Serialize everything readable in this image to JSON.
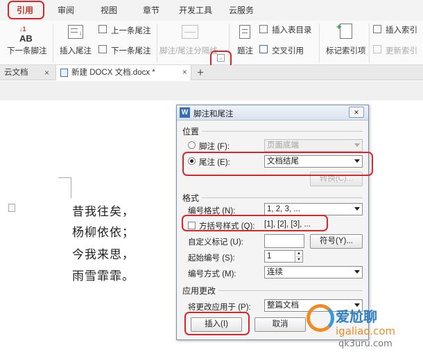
{
  "ribbon": {
    "tabs": [
      "引用",
      "审阅",
      "视图",
      "章节",
      "开发工具",
      "云服务"
    ],
    "active_tab": "引用",
    "items": {
      "next_footnote": "下一条脚注",
      "insert_endnote": "插入尾注",
      "prev_endnote": "上一条尾注",
      "next_endnote": "下一条尾注",
      "separator": "脚注/尾注分隔线",
      "caption": "题注",
      "insert_table_toc": "插入表目录",
      "cross_ref": "交叉引用",
      "mark_index": "标记索引项",
      "insert_index": "插入索引",
      "update_index": "更新索引"
    }
  },
  "doc_tabs": {
    "cloud": "云文档",
    "doc": "新建 DOCX 文档.docx *"
  },
  "document": {
    "lines": [
      "昔我往矣，",
      "杨柳依依；",
      "今我来思，",
      "雨雪霏霏。"
    ]
  },
  "dialog": {
    "title": "脚注和尾注",
    "position_label": "位置",
    "footnote_label": "脚注 (F):",
    "footnote_value": "页面底端",
    "endnote_label": "尾注 (E):",
    "endnote_value": "文档结尾",
    "convert_btn": "转换(C)...",
    "format_label": "格式",
    "number_format_label": "编号格式 (N):",
    "number_format_value": "1, 2, 3, ...",
    "bracket_label": "方括号样式 (Q):",
    "bracket_value": "[1], [2], [3], ...",
    "custom_mark_label": "自定义标记 (U):",
    "custom_mark_value": "",
    "symbol_btn": "符号(Y)...",
    "start_at_label": "起始编号 (S):",
    "start_at_value": "1",
    "numbering_label": "编号方式 (M):",
    "numbering_value": "连续",
    "apply_label": "应用更改",
    "apply_to_label": "将更改应用于 (P):",
    "apply_to_value": "整篇文档",
    "insert_btn": "插入(I)",
    "cancel_btn": "取消"
  },
  "watermark": {
    "line1": "爱尬聊",
    "line2": "igaliao.com",
    "line3": "qk3uru.com"
  },
  "colors": {
    "highlight": "#d8262b",
    "active_tab": "#c0392b"
  }
}
